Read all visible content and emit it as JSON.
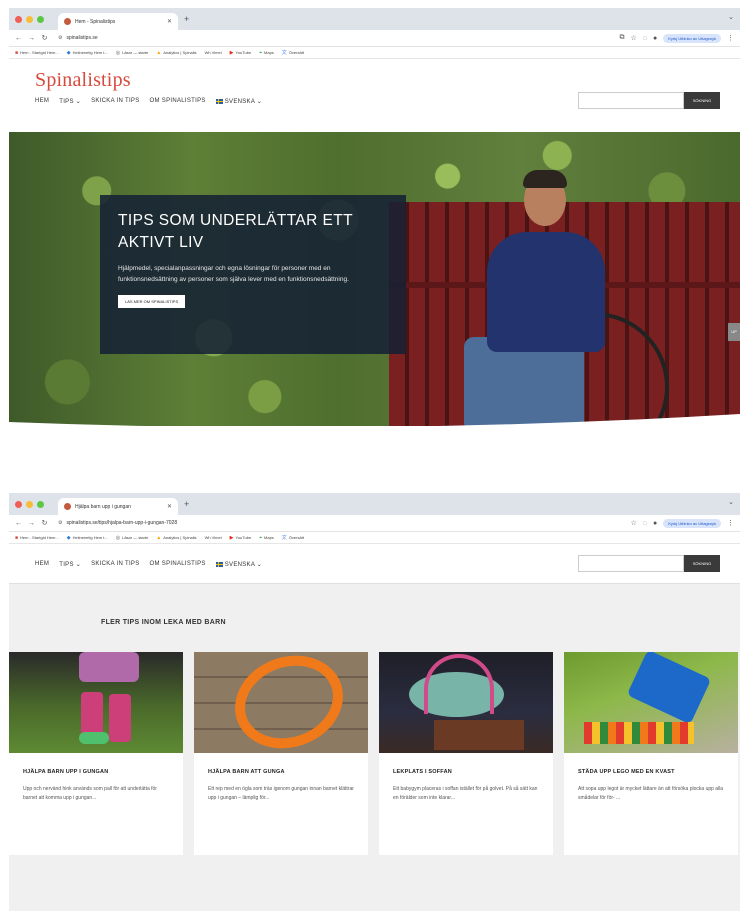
{
  "screens": [
    {
      "browser": {
        "tab_title": "Hem - Spinalistips",
        "url": "spinalistips.se",
        "profile": "Kyrkj Uthinko av Uttagsnyk",
        "bookmarks": [
          "Hem - Startgid Hem...",
          "Helinenetig Hem t...",
          "Läsar — starte",
          "Analytics | Spinalis",
          "Wh Vimel",
          "YouTube",
          "Maps",
          "Översätt"
        ]
      },
      "site": {
        "logo": "Spinalistips",
        "nav": [
          "HEM",
          "TIPS ⌄",
          "SKICKA IN TIPS",
          "OM SPINALISTIPS",
          "SVENSKA ⌄"
        ],
        "search_placeholder": "",
        "search_button": "SÖKNING"
      },
      "hero": {
        "title": "TIPS SOM UNDERLÄTTAR ETT AKTIVT LIV",
        "text": "Hjälpmedel, specialanpassningar och egna lösningar för personer med en funktionsnedsättning av personer som själva lever med en funktionsnedsättning.",
        "button": "LÄS MER OM SPINALISTIPS"
      }
    },
    {
      "browser": {
        "tab_title": "Hjälpa barn upp i gungan",
        "url": "spinalistips.se/tips/hjalpa-barn-upp-i-gungan-7028",
        "profile": "Kyrkj Uthinko av Uttagsnyk",
        "bookmarks": [
          "Hem - Startgid Hem...",
          "Helinenetig Hem t...",
          "Läsar — starte",
          "Analytics | Spinalis",
          "Wh Vimel",
          "YouTube",
          "Maps",
          "Översätt"
        ]
      },
      "site": {
        "nav": [
          "HEM",
          "TIPS ⌄",
          "SKICKA IN TIPS",
          "OM SPINALISTIPS",
          "SVENSKA ⌄"
        ],
        "search_placeholder": "",
        "search_button": "SÖKNING"
      },
      "section_title": "FLER TIPS INOM LEKA MED BARN",
      "cards": [
        {
          "title": "HJÄLPA BARN UPP I GUNGAN",
          "text": "Upp och nervänd hink används som pall för att underlätta för barnet att komma upp i gungan..."
        },
        {
          "title": "HJÄLPA BARN ATT GUNGA",
          "text": "Ett rep med en ögla som träs igenom gungan innan barnet klättrar upp i gungan – lämplig för..."
        },
        {
          "title": "LEKPLATS I SOFFAN",
          "text": "Ett babygym placeras i soffan istället för på golvet. På så sätt kan en förälder som inte klarar..."
        },
        {
          "title": "STÄDA UPP LEGO MED EN KVAST",
          "text": "Att sopa upp legot är mycket lättare än att försöka plocka upp alla smådelar för för- ..."
        }
      ],
      "scroll_top": "UP"
    }
  ]
}
